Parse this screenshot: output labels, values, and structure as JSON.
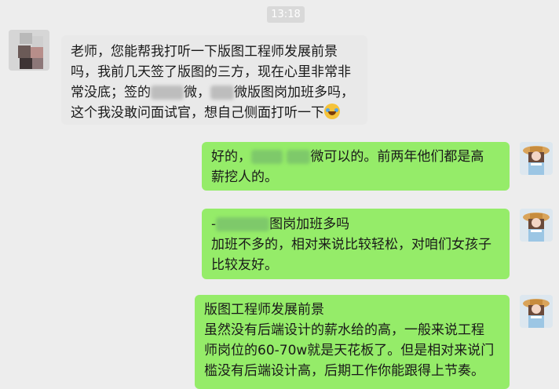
{
  "timestamp": "13:18",
  "messages": [
    {
      "side": "in",
      "line1": "老师，您能帮我打听一下版图工程师发展前景",
      "line2": "吗，我前几天签了版图的三方，现在心里非常非",
      "line3a": "常没底；签的",
      "line3b": "微，",
      "line3c": "微版图岗加班多吗，",
      "line4": "这个我没敢问面试官，想自己侧面打听一下",
      "emoji": "laugh-with-tears-icon"
    },
    {
      "side": "out",
      "line1a": "好的，",
      "line1b": "微可以的。前两年他们都是高",
      "line2": "薪挖人的。"
    },
    {
      "side": "out",
      "line1a": "-",
      "line1b": "图岗加班多吗",
      "line2": "加班不多的，相对来说比较轻松，对咱们女孩子",
      "line3": "比较友好。"
    },
    {
      "side": "out",
      "line1": "版图工程师发展前景",
      "line2": "虽然没有后端设计的薪水给的高，一般来说工程",
      "line3": "师岗位的60-70w就是天花板了。但是相对来说门",
      "line4": "槛没有后端设计高，后期工作你能跟得上节奏。"
    }
  ],
  "colors": {
    "background": "#ededed",
    "incoming_bubble": "#e9e9e9",
    "outgoing_bubble": "#95ec69",
    "time_chip": "#d9d9d9"
  }
}
